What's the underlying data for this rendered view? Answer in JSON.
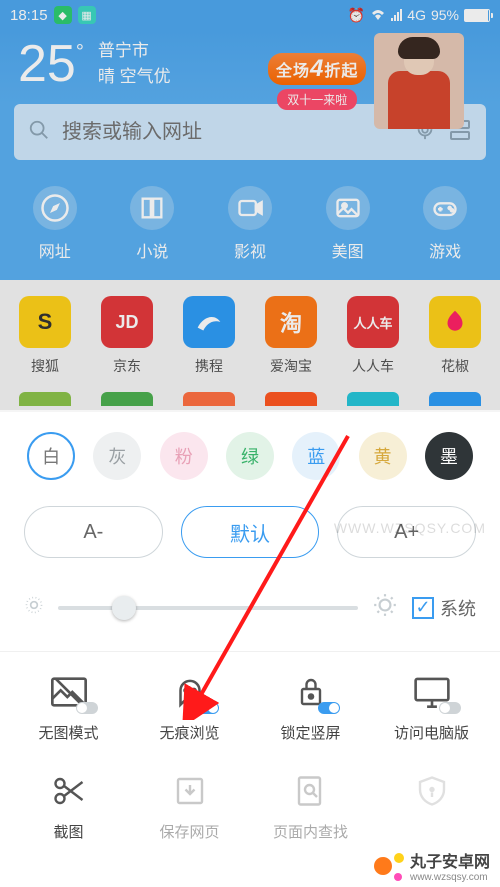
{
  "status": {
    "time": "18:15",
    "network": "4G",
    "battery": "95%"
  },
  "weather": {
    "temp": "25",
    "city": "普宁市",
    "detail": "晴 空气优"
  },
  "promo": {
    "line1a": "全场",
    "line1b": "4",
    "line1c": "折起",
    "line2": "双十一来啦"
  },
  "search": {
    "placeholder": "搜索或输入网址"
  },
  "nav": [
    {
      "label": "网址"
    },
    {
      "label": "小说"
    },
    {
      "label": "影视"
    },
    {
      "label": "美图"
    },
    {
      "label": "游戏"
    }
  ],
  "apps": [
    {
      "label": "搜狐",
      "badge": "S",
      "bg": "#ffd21a",
      "fg": "#333"
    },
    {
      "label": "京东",
      "badge": "JD",
      "bg": "#e4393c",
      "fg": "#fff"
    },
    {
      "label": "携程",
      "badge": "",
      "bg": "#2e9df7",
      "fg": "#fff"
    },
    {
      "label": "爱淘宝",
      "badge": "淘",
      "bg": "#ff7a1a",
      "fg": "#fff"
    },
    {
      "label": "人人车",
      "badge": "人人车",
      "bg": "#e4393c",
      "fg": "#fff"
    },
    {
      "label": "花椒",
      "badge": "",
      "bg": "#ffd21a",
      "fg": "#333"
    }
  ],
  "colors": [
    {
      "label": "白",
      "text": "#777",
      "bg": "#ffffff",
      "border": "#3a9cf0",
      "selected": true
    },
    {
      "label": "灰",
      "text": "#9aa0a4",
      "bg": "#eef0f1"
    },
    {
      "label": "粉",
      "text": "#e8a0b6",
      "bg": "#fbe6ee"
    },
    {
      "label": "绿",
      "text": "#39b26a",
      "bg": "#e2f3e7"
    },
    {
      "label": "蓝",
      "text": "#3a9cf0",
      "bg": "#e5f1fb"
    },
    {
      "label": "黄",
      "text": "#d6a83c",
      "bg": "#f7efd6"
    },
    {
      "label": "墨",
      "text": "#ffffff",
      "bg": "#2f3538"
    }
  ],
  "font": {
    "minus": "A-",
    "default": "默认",
    "plus": "A+"
  },
  "brightness": {
    "system_label": "系统"
  },
  "tools": [
    {
      "label": "无图模式",
      "toggle": "off"
    },
    {
      "label": "无痕浏览",
      "toggle": "on"
    },
    {
      "label": "锁定竖屏",
      "toggle": "on"
    },
    {
      "label": "访问电脑版",
      "toggle": "off"
    },
    {
      "label": "截图"
    },
    {
      "label": "保存网页",
      "faded": true
    },
    {
      "label": "页面内查找",
      "faded": true
    },
    {
      "label": "",
      "faded": true
    }
  ],
  "watermark": "WWW.WZSQSY.COM",
  "brand": {
    "name": "丸子安卓网",
    "sub": "www.wzsqsy.com"
  }
}
